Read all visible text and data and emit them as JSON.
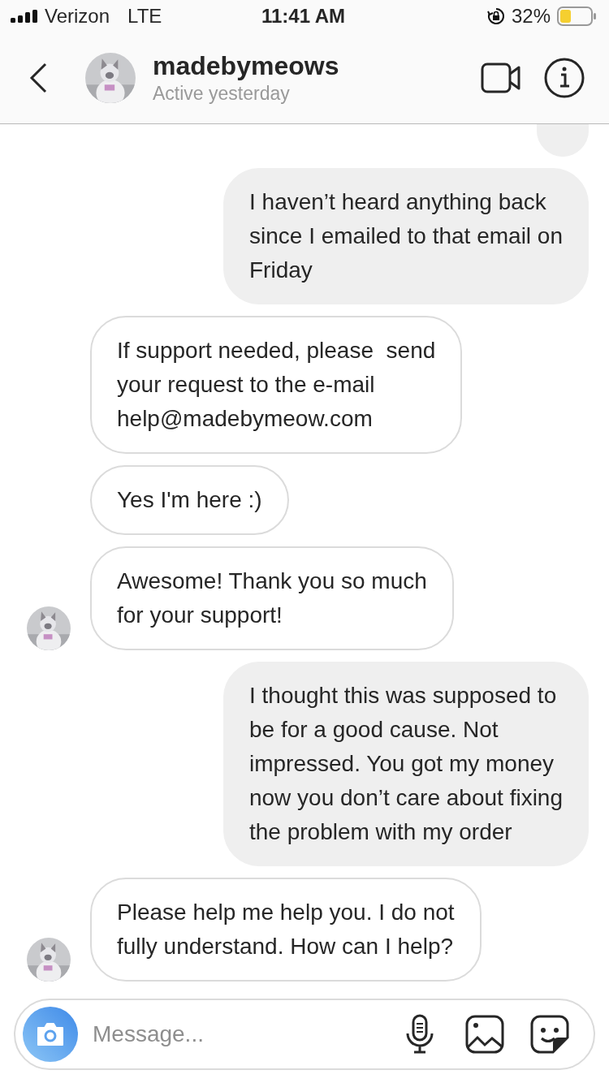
{
  "status_bar": {
    "carrier": "Verizon",
    "network": "LTE",
    "time": "11:41 AM",
    "battery": "32%"
  },
  "header": {
    "name": "madebymeows",
    "status": "Active yesterday"
  },
  "messages": [
    {
      "kind": "outgoing",
      "avatar": false
    },
    {
      "kind": "outgoing",
      "avatar": false,
      "text": "I haven’t heard anything back\nsince I emailed to that email on\nFriday"
    },
    {
      "kind": "incoming",
      "avatar": false,
      "text": "If support needed, please  send\nyour request to the e-mail\nhelp@madebymeow.com"
    },
    {
      "kind": "incoming",
      "avatar": false,
      "text": "Yes I'm here :)"
    },
    {
      "kind": "incoming",
      "avatar": true,
      "text": "Awesome! Thank you so much\nfor your support!"
    },
    {
      "kind": "outgoing",
      "avatar": false,
      "text": "I thought this was supposed to\nbe for a good cause. Not\nimpressed. You got my money\nnow you don’t care about fixing\nthe problem with my order"
    },
    {
      "kind": "incoming",
      "avatar": true,
      "text": "Please help me help you. I do not\nfully understand. How can I help?"
    }
  ],
  "composer": {
    "placeholder": "Message..."
  }
}
